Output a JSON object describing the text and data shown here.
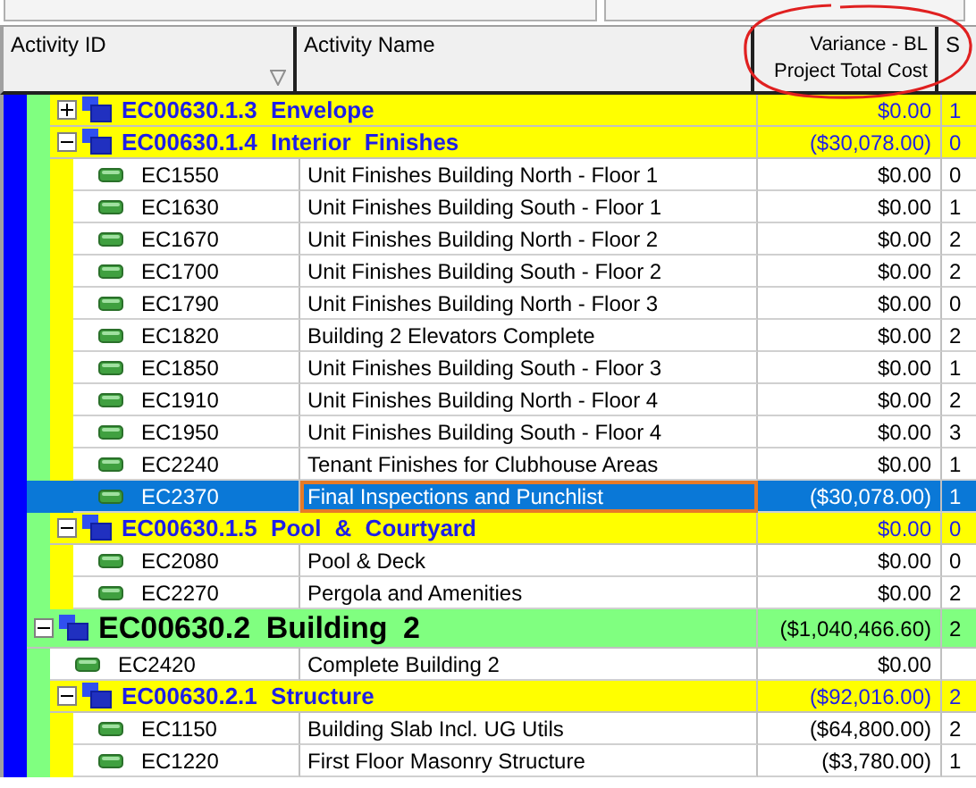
{
  "columns": [
    {
      "label": "Activity ID",
      "filter": true
    },
    {
      "label": "Activity Name"
    },
    {
      "label": "Variance - BL Project Total Cost"
    },
    {
      "label": "S"
    }
  ],
  "tree": [
    {
      "kind": "band",
      "children": [
        {
          "kind": "wbs",
          "id": "EC00630.1.3",
          "name": "Envelope",
          "variance": "$0.00",
          "column_4": "1",
          "expanded": false,
          "selected": false
        },
        {
          "kind": "wbs",
          "id": "EC00630.1.4",
          "name": "Interior Finishes",
          "variance": "($30,078.00)",
          "column_4": "0",
          "expanded": true,
          "selected": false,
          "children": [
            {
              "kind": "activity",
              "id": "EC1550",
              "name": "Unit Finishes Building North - Floor 1",
              "variance": "$0.00",
              "column_4": "0",
              "selected": false
            },
            {
              "kind": "activity",
              "id": "EC1630",
              "name": "Unit Finishes Building South - Floor 1",
              "variance": "$0.00",
              "column_4": "1",
              "selected": false
            },
            {
              "kind": "activity",
              "id": "EC1670",
              "name": "Unit Finishes Building North - Floor 2",
              "variance": "$0.00",
              "column_4": "2",
              "selected": false
            },
            {
              "kind": "activity",
              "id": "EC1700",
              "name": "Unit Finishes Building South - Floor 2",
              "variance": "$0.00",
              "column_4": "2",
              "selected": false
            },
            {
              "kind": "activity",
              "id": "EC1790",
              "name": "Unit Finishes Building North - Floor 3",
              "variance": "$0.00",
              "column_4": "0",
              "selected": false
            },
            {
              "kind": "activity",
              "id": "EC1820",
              "name": "Building 2 Elevators Complete",
              "variance": "$0.00",
              "column_4": "2",
              "selected": false
            },
            {
              "kind": "activity",
              "id": "EC1850",
              "name": "Unit Finishes Building South - Floor 3",
              "variance": "$0.00",
              "column_4": "1",
              "selected": false
            },
            {
              "kind": "activity",
              "id": "EC1910",
              "name": "Unit Finishes Building North - Floor 4",
              "variance": "$0.00",
              "column_4": "2",
              "selected": false
            },
            {
              "kind": "activity",
              "id": "EC1950",
              "name": "Unit Finishes Building South - Floor 4",
              "variance": "$0.00",
              "column_4": "3",
              "selected": false
            },
            {
              "kind": "activity",
              "id": "EC2240",
              "name": "Tenant Finishes for Clubhouse Areas",
              "variance": "$0.00",
              "column_4": "1",
              "selected": false
            },
            {
              "kind": "activity",
              "id": "EC2370",
              "name": "Final Inspections and Punchlist",
              "variance": "($30,078.00)",
              "column_4": "1",
              "selected": true
            }
          ]
        },
        {
          "kind": "wbs",
          "id": "EC00630.1.5",
          "name": "Pool & Courtyard",
          "variance": "$0.00",
          "column_4": "0",
          "expanded": true,
          "selected": false,
          "children": [
            {
              "kind": "activity",
              "id": "EC2080",
              "name": "Pool & Deck",
              "variance": "$0.00",
              "column_4": "0",
              "selected": false
            },
            {
              "kind": "activity",
              "id": "EC2270",
              "name": "Pergola and Amenities",
              "variance": "$0.00",
              "column_4": "2",
              "selected": false
            }
          ]
        }
      ]
    },
    {
      "kind": "wbs",
      "id": "EC00630.2",
      "name": "Building 2",
      "variance": "($1,040,466.60)",
      "column_4": "2",
      "expanded": true,
      "selected": false,
      "children": [
        {
          "kind": "activity",
          "id": "EC2420",
          "name": "Complete Building 2",
          "variance": "$0.00",
          "selected": false
        },
        {
          "kind": "wbs",
          "id": "EC00630.2.1",
          "name": "Structure",
          "variance": "($92,016.00)",
          "column_4": "2",
          "expanded": true,
          "selected": false,
          "children": [
            {
              "kind": "activity",
              "id": "EC1150",
              "name": "Building Slab Incl. UG Utils",
              "variance": "($64,800.00)",
              "column_4": "2",
              "selected": false
            },
            {
              "kind": "activity",
              "id": "EC1220",
              "name": "First Floor Masonry Structure",
              "variance": "($3,780.00)",
              "column_4": "1",
              "selected": false
            }
          ]
        }
      ]
    }
  ]
}
